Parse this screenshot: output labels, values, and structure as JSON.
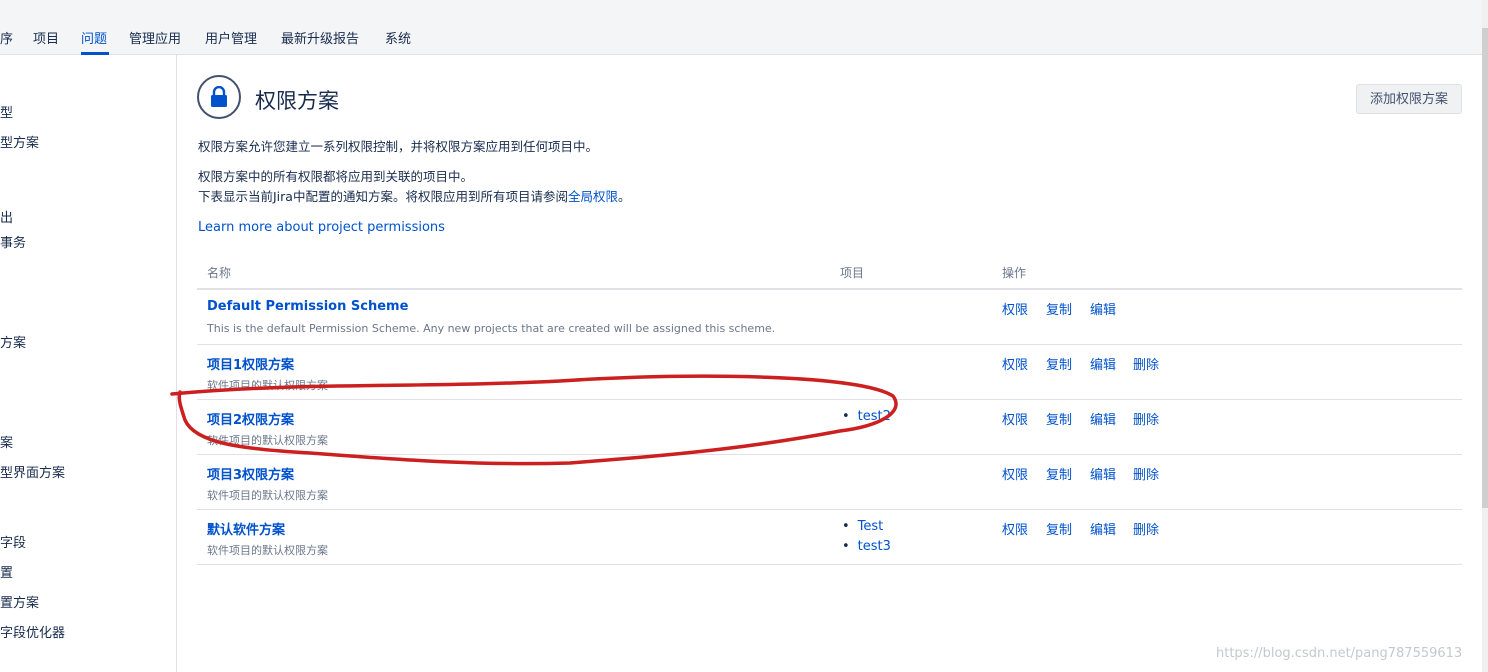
{
  "topnav": {
    "tabs": [
      {
        "label": "序"
      },
      {
        "label": "项目"
      },
      {
        "label": "问题"
      },
      {
        "label": "管理应用"
      },
      {
        "label": "用户管理"
      },
      {
        "label": "最新升级报告"
      },
      {
        "label": "系统"
      }
    ],
    "active_tab": "问题"
  },
  "sidebar": {
    "items": [
      {
        "label": "型"
      },
      {
        "label": "型方案"
      },
      {
        "label": "出"
      },
      {
        "label": "事务"
      },
      {
        "label": "方案"
      },
      {
        "label": "案"
      },
      {
        "label": "型界面方案"
      },
      {
        "label": "字段"
      },
      {
        "label": "置"
      },
      {
        "label": "置方案"
      },
      {
        "label": "字段优化器"
      }
    ]
  },
  "page": {
    "title": "权限方案",
    "add_button": "添加权限方案",
    "desc1": "权限方案允许您建立一系列权限控制，并将权限方案应用到任何项目中。",
    "desc2": "权限方案中的所有权限都将应用到关联的项目中。",
    "desc3_prefix": "下表显示当前Jira中配置的通知方案。将权限应用到所有项目请参阅",
    "desc3_link": "全局权限",
    "desc3_suffix": "。",
    "learn_more": "Learn more about project permissions"
  },
  "table": {
    "headers": {
      "name": "名称",
      "projects": "项目",
      "actions": "操作"
    },
    "rows": [
      {
        "name": "Default Permission Scheme",
        "description": "This is the default Permission Scheme. Any new projects that are created will be assigned this scheme.",
        "projects": [],
        "actions": [
          "权限",
          "复制",
          "编辑"
        ]
      },
      {
        "name": "项目1权限方案",
        "description": "软件项目的默认权限方案",
        "projects": [],
        "actions": [
          "权限",
          "复制",
          "编辑",
          "删除"
        ]
      },
      {
        "name": "项目2权限方案",
        "description": "软件项目的默认权限方案",
        "projects": [
          "test2"
        ],
        "actions": [
          "权限",
          "复制",
          "编辑",
          "删除"
        ]
      },
      {
        "name": "项目3权限方案",
        "description": "软件项目的默认权限方案",
        "projects": [],
        "actions": [
          "权限",
          "复制",
          "编辑",
          "删除"
        ]
      },
      {
        "name": "默认软件方案",
        "description": "软件项目的默认权限方案",
        "projects": [
          "Test",
          "test3"
        ],
        "actions": [
          "权限",
          "复制",
          "编辑",
          "删除"
        ]
      }
    ]
  },
  "bullet": "•",
  "watermark": "https://blog.csdn.net/pang787559613",
  "colors": {
    "link": "#0052cc",
    "annotation": "#cc1f1f",
    "text": "#172b4d",
    "muted": "#6b778c"
  }
}
